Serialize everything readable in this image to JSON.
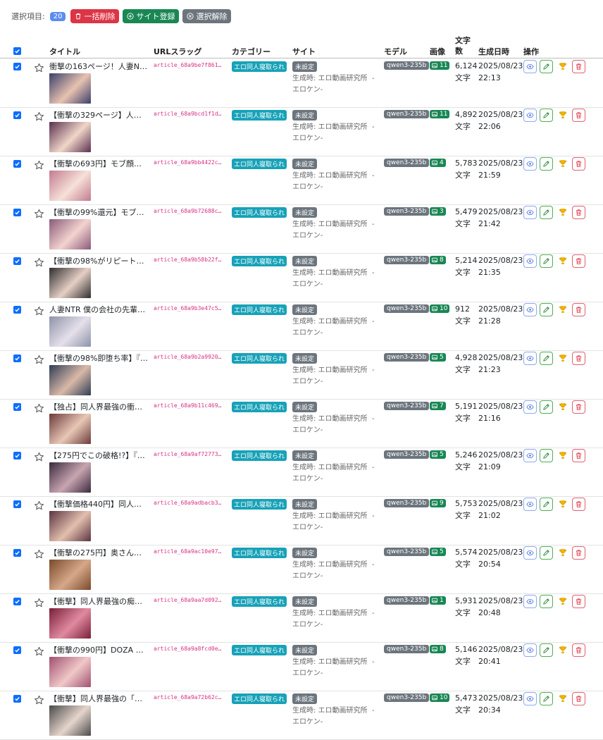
{
  "toolbar": {
    "selected_label": "選択項目:",
    "selected_count": "20",
    "bulk_delete_label": "一括削除",
    "add_site_label": "サイト登録",
    "deselect_label": "選択解除"
  },
  "table": {
    "headers": {
      "title": "タイトル",
      "slug": "URLスラッグ",
      "category": "カテゴリー",
      "site": "サイト",
      "model": "モデル",
      "images": "画像",
      "chars": "文字数",
      "date": "生成日時",
      "actions": "操作"
    },
    "rows": [
      {
        "title": "衝撃の163ページ！人妻NTR…",
        "slug": "article_68a9be7f861…",
        "category": "エロ同人寝取られ",
        "site": "未設定",
        "source": "生成時: エロ動画研究所",
        "source_dash": "-",
        "source2": "エロケン-",
        "model": "qwen3-235b",
        "images": "11",
        "chars": "6,124",
        "chars_unit": "文字",
        "date": "2025/08/23",
        "time": "22:13"
      },
      {
        "title": "【衝撃の329ページ】人妻NT…",
        "slug": "article_68a9bcd1f1d…",
        "category": "エロ同人寝取られ",
        "site": "未設定",
        "source": "生成時: エロ動画研究所",
        "source_dash": "-",
        "source2": "エロケン-",
        "model": "qwen3-235b",
        "images": "11",
        "chars": "4,892",
        "chars_unit": "文字",
        "date": "2025/08/23",
        "time": "22:06"
      },
      {
        "title": "【衝撃の693円】モブ顔巨乳…",
        "slug": "article_68a9bb4422c…",
        "category": "エロ同人寝取られ",
        "site": "未設定",
        "source": "生成時: エロ動画研究所",
        "source_dash": "-",
        "source2": "エロケン-",
        "model": "qwen3-235b",
        "images": "4",
        "chars": "5,783",
        "chars_unit": "文字",
        "date": "2025/08/23",
        "time": "21:59"
      },
      {
        "title": "【衝撃の99%還元】モブ顔巨…",
        "slug": "article_68a9b72688c…",
        "category": "エロ同人寝取られ",
        "site": "未設定",
        "source": "生成時: エロ動画研究所",
        "source_dash": "-",
        "source2": "エロケン-",
        "model": "qwen3-235b",
        "images": "3",
        "chars": "5,479",
        "chars_unit": "文字",
        "date": "2025/08/23",
        "time": "21:42"
      },
      {
        "title": "【衝撃の98%がリピート購入…",
        "slug": "article_68a9b58b22f…",
        "category": "エロ同人寝取られ",
        "site": "未設定",
        "source": "生成時: エロ動画研究所",
        "source_dash": "-",
        "source2": "エロケン-",
        "model": "qwen3-235b",
        "images": "8",
        "chars": "5,214",
        "chars_unit": "文字",
        "date": "2025/08/23",
        "time": "21:35"
      },
      {
        "title": "人妻NTR 僕の会社の先輩に…",
        "slug": "article_68a9b3e47c5…",
        "category": "エロ同人寝取られ",
        "site": "未設定",
        "source": "生成時: エロ動画研究所",
        "source_dash": "-",
        "source2": "エロケン-",
        "model": "qwen3-235b",
        "images": "10",
        "chars": "912",
        "chars_unit": "文字",
        "date": "2025/08/23",
        "time": "21:28"
      },
      {
        "title": "【衝撃の98%即堕ち率】『即…",
        "slug": "article_68a9b2a9920…",
        "category": "エロ同人寝取られ",
        "site": "未設定",
        "source": "生成時: エロ動画研究所",
        "source_dash": "-",
        "source2": "エロケン-",
        "model": "qwen3-235b",
        "images": "5",
        "chars": "4,928",
        "chars_unit": "文字",
        "date": "2025/08/23",
        "time": "21:23"
      },
      {
        "title": "【独占】同人界最強の衝撃…",
        "slug": "article_68a9b11c469…",
        "category": "エロ同人寝取られ",
        "site": "未設定",
        "source": "生成時: エロ動画研究所",
        "source_dash": "-",
        "source2": "エロケン-",
        "model": "qwen3-235b",
        "images": "7",
        "chars": "5,191",
        "chars_unit": "文字",
        "date": "2025/08/23",
        "time": "21:16"
      },
      {
        "title": "【275円でこの破格!?】『春…",
        "slug": "article_68a9af72773…",
        "category": "エロ同人寝取られ",
        "site": "未設定",
        "source": "生成時: エロ動画研究所",
        "source_dash": "-",
        "source2": "エロケン-",
        "model": "qwen3-235b",
        "images": "5",
        "chars": "5,246",
        "chars_unit": "文字",
        "date": "2025/08/23",
        "time": "21:09"
      },
      {
        "title": "【衝撃価格440円】同人界衝…",
        "slug": "article_68a9adbacb3…",
        "category": "エロ同人寝取られ",
        "site": "未設定",
        "source": "生成時: エロ動画研究所",
        "source_dash": "-",
        "source2": "エロケン-",
        "model": "qwen3-235b",
        "images": "9",
        "chars": "5,753",
        "chars_unit": "文字",
        "date": "2025/08/23",
        "time": "21:02"
      },
      {
        "title": "【衝撃の275円】奥さんのお…",
        "slug": "article_68a9ac10e97…",
        "category": "エロ同人寝取られ",
        "site": "未設定",
        "source": "生成時: エロ動画研究所",
        "source_dash": "-",
        "source2": "エロケン-",
        "model": "qwen3-235b",
        "images": "5",
        "chars": "5,574",
        "chars_unit": "文字",
        "date": "2025/08/23",
        "time": "20:54"
      },
      {
        "title": "【衝撃】同人界最強の痴女…",
        "slug": "article_68a9aa7d092…",
        "category": "エロ同人寝取られ",
        "site": "未設定",
        "source": "生成時: エロ動画研究所",
        "source_dash": "-",
        "source2": "エロケン-",
        "model": "qwen3-235b",
        "images": "1",
        "chars": "5,931",
        "chars_unit": "文字",
        "date": "2025/08/23",
        "time": "20:48"
      },
      {
        "title": "【衝撃の990円】DOZA Villa…",
        "slug": "article_68a9a8fcd0e…",
        "category": "エロ同人寝取られ",
        "site": "未設定",
        "source": "生成時: エロ動画研究所",
        "source_dash": "-",
        "source2": "エロケン-",
        "model": "qwen3-235b",
        "images": "8",
        "chars": "5,146",
        "chars_unit": "文字",
        "date": "2025/08/23",
        "time": "20:41"
      },
      {
        "title": "【衝撃】同人界最強の「染…",
        "slug": "article_68a9a72b62c…",
        "category": "エロ同人寝取られ",
        "site": "未設定",
        "source": "生成時: エロ動画研究所",
        "source_dash": "-",
        "source2": "エロケン-",
        "model": "qwen3-235b",
        "images": "10",
        "chars": "5,473",
        "chars_unit": "文字",
        "date": "2025/08/23",
        "time": "20:34"
      }
    ]
  },
  "colors": {
    "primary": "#0d6efd",
    "danger": "#dc3545",
    "success": "#198754",
    "secondary": "#6c757d",
    "info": "#17a2b8",
    "slug_text": "#d63384",
    "trophy": "#f0b400"
  },
  "icons": {
    "checkbox": "check-icon",
    "favorite": "star-icon",
    "view": "eye-icon",
    "edit": "pencil-icon",
    "award": "trophy-icon",
    "delete": "trash-icon",
    "images": "image-icon"
  }
}
